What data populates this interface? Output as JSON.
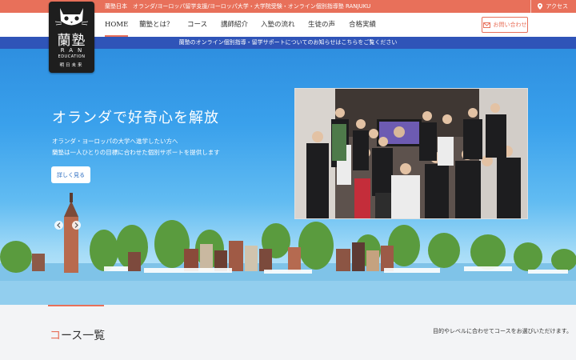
{
  "topbar": {
    "text": "蘭塾日本　オランダ/ヨーロッパ留学支援/ヨーロッパ大学・大学院受験・オンライン個別指導塾 RANJUKU",
    "access_label": "アクセス"
  },
  "logo": {
    "kanji": "蘭塾",
    "ran": "RAN",
    "education": "EDUCATION",
    "tagline": "明日未来"
  },
  "nav": {
    "items": [
      "HOME",
      "蘭塾とは？",
      "コース",
      "講師紹介",
      "入塾の流れ",
      "生徒の声",
      "合格実績"
    ],
    "active": "HOME",
    "contact_label": "お問い合わせ"
  },
  "announcement": "蘭塾のオンライン個別指導・留学サポートについてのお知らせはこちらをご覧ください",
  "hero": {
    "title": "オランダで好奇心を解放",
    "subtitle_1": "オランダ・ヨーロッパの大学へ進学したい方へ",
    "subtitle_2": "蘭塾は一人ひとりの目標に合わせた個別サポートを提供します",
    "button_label": "詳しく見る"
  },
  "section": {
    "title_first": "コ",
    "title_rest": "ース一覧",
    "right_text": "目的やレベルに合わせてコースをお選びいただけます。"
  },
  "colors": {
    "accent": "#e8705a",
    "announcement_bar": "#2f54b8",
    "sky_top": "#2e8fe0"
  }
}
